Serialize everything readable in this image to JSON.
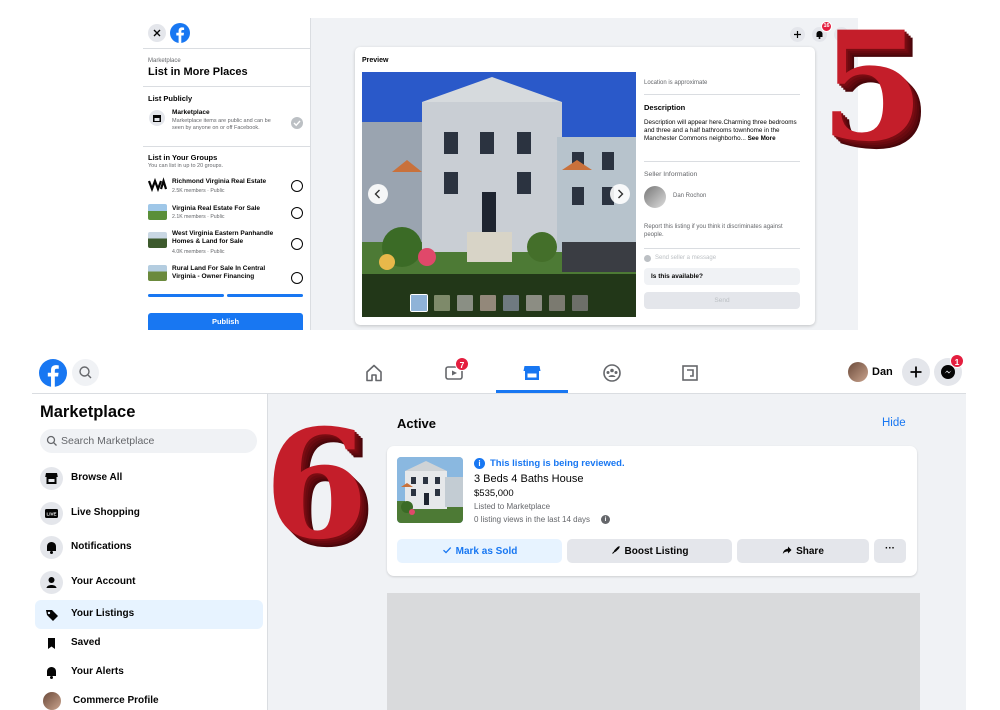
{
  "step_five": {
    "number": "5",
    "left_panel": {
      "breadcrumb": "Marketplace",
      "title": "List in More Places",
      "list_publicly": "List Publicly",
      "marketplace": {
        "name": "Marketplace",
        "desc": "Marketplace items are public and can be seen by anyone on or off Facebook."
      },
      "groups_heading": "List in Your Groups",
      "groups_sub": "You can list in up to 20 groups.",
      "groups": [
        {
          "name": "Richmond Virginia Real Estate",
          "meta": "2.5K members · Public"
        },
        {
          "name": "Virginia Real Estate For Sale",
          "meta": "2.1K members · Public"
        },
        {
          "name": "West Virginia Eastern Panhandle Homes & Land for Sale",
          "meta": "4.0K members · Public"
        },
        {
          "name": "Rural Land For Sale In Central Virginia - Owner Financing",
          "meta": ""
        }
      ],
      "publish": "Publish"
    },
    "top_bar": {
      "notification_count": "16"
    },
    "preview": {
      "label": "Preview",
      "location_note": "Location is approximate",
      "description_heading": "Description",
      "description": "Description will appear here.Charming three bedrooms and three and a half bathrooms townhome in the Manchester Commons neighborho...",
      "see_more": "See More",
      "seller_heading": "Seller Information",
      "seller_name": "Dan Rochon",
      "report": "Report this listing if you think it discriminates against people.",
      "send_label": "Send seller a message",
      "message_value": "Is this available?",
      "send_button": "Send"
    }
  },
  "step_six": {
    "number": "6",
    "nav": {
      "watch_badge": "7",
      "user_name": "Dan",
      "messenger_badge": "1"
    },
    "sidebar": {
      "title": "Marketplace",
      "search_placeholder": "Search Marketplace",
      "items": [
        {
          "label": "Browse All",
          "icon": "storefront-icon"
        },
        {
          "label": "Live Shopping",
          "icon": "live-icon"
        },
        {
          "label": "Notifications",
          "icon": "bell-icon"
        },
        {
          "label": "Your Account",
          "icon": "person-icon"
        },
        {
          "label": "Your Listings",
          "icon": "tag-icon",
          "active": true
        },
        {
          "label": "Saved",
          "icon": "bookmark-icon"
        },
        {
          "label": "Your Alerts",
          "icon": "bell-alert-icon"
        },
        {
          "label": "Commerce Profile",
          "icon": "avatar-icon"
        }
      ]
    },
    "main": {
      "section_title": "Active",
      "hide": "Hide",
      "listing": {
        "review_status": "This listing is being reviewed.",
        "title": "3 Beds 4 Baths House",
        "price": "$535,000",
        "listed_to": "Listed to Marketplace",
        "views": "0 listing views in the last 14 days",
        "actions": {
          "mark_sold": "Mark as Sold",
          "boost": "Boost Listing",
          "share": "Share",
          "more": "···"
        }
      }
    }
  },
  "colors": {
    "facebook_blue": "#1877f2",
    "badge_red": "#e41e3f",
    "step_red": "#c41e2a"
  }
}
